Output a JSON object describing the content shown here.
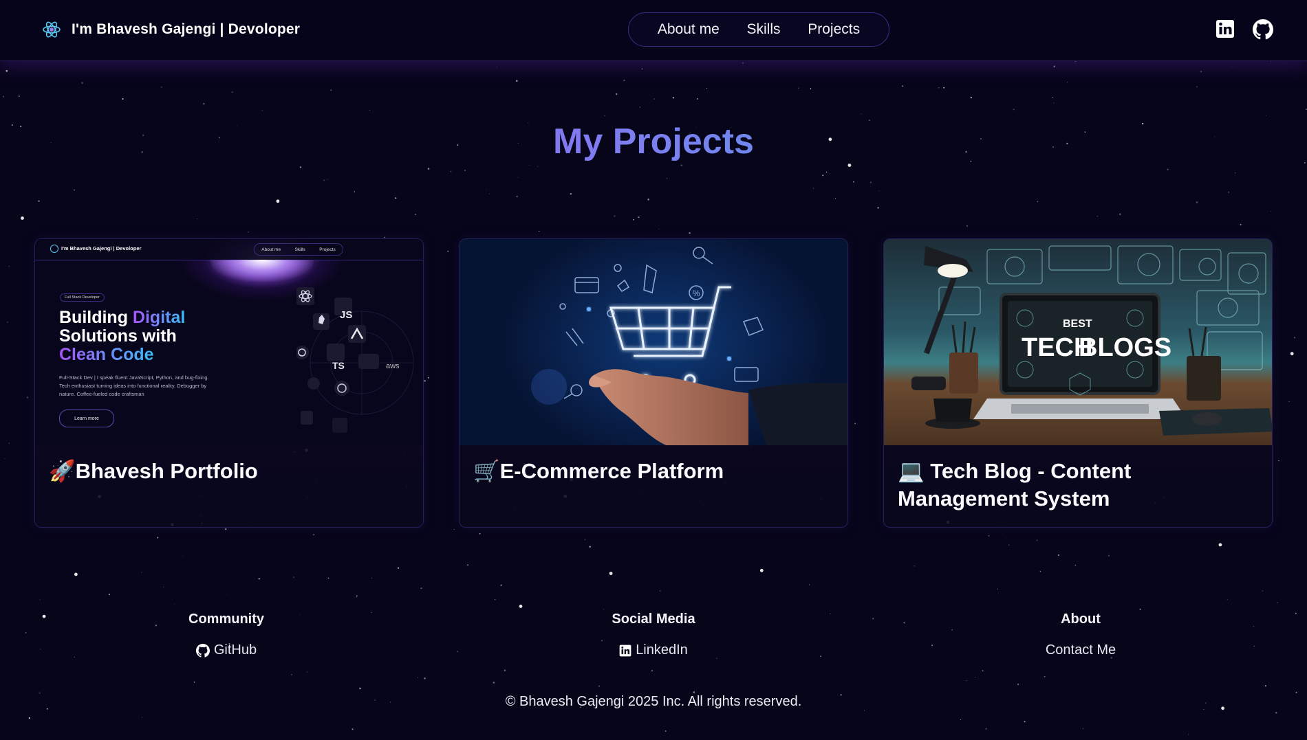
{
  "brand": {
    "title": "I'm Bhavesh Gajengi | Devoloper",
    "logo_icon": "atom-icon"
  },
  "nav": {
    "links": [
      "About me",
      "Skills",
      "Projects"
    ]
  },
  "social": {
    "linkedin_icon": "linkedin-icon",
    "github_icon": "github-icon"
  },
  "page": {
    "title": "My Projects"
  },
  "projects": [
    {
      "title": "🚀Bhavesh Portfolio",
      "image": "portfolio-preview"
    },
    {
      "title": "🛒E-Commerce Platform",
      "image": "shopping-cart-hologram"
    },
    {
      "title": "💻 Tech Blog - Content Management System",
      "image": "tech-blogs-desk"
    }
  ],
  "preview": {
    "brand": "I'm Bhavesh Gajengi | Devoloper",
    "nav": [
      "About me",
      "Skills",
      "Projects"
    ],
    "badge": "Full Stack Developer",
    "heading_1": "Building ",
    "heading_2": "Digital",
    "heading_3": "Solutions with",
    "heading_4": "Clean Code",
    "paragraph": "Full-Stack Dev | I speak fluent JavaScript, Python, and bug-fixing. Tech enthusiast turning ideas into functional reality. Debugger by nature. Coffee-fueled code craftsman",
    "button": "Learn more",
    "chips": [
      "JS",
      "TS",
      "aws"
    ]
  },
  "blog_image": {
    "line1": "BEST",
    "line2": "TECH",
    "line3": "BLOGS"
  },
  "footer": {
    "columns": [
      {
        "heading": "Community",
        "link": "GitHub",
        "icon": "github-icon"
      },
      {
        "heading": "Social Media",
        "link": "LinkedIn",
        "icon": "linkedin-icon"
      },
      {
        "heading": "About",
        "link": "Contact Me",
        "icon": ""
      }
    ],
    "copyright": "© Bhavesh Gajengi 2025 Inc. All rights reserved."
  },
  "colors": {
    "background": "#07051a",
    "accent_purple": "#a855f7",
    "accent_blue": "#38b8e8",
    "card_border": "#24205a"
  }
}
